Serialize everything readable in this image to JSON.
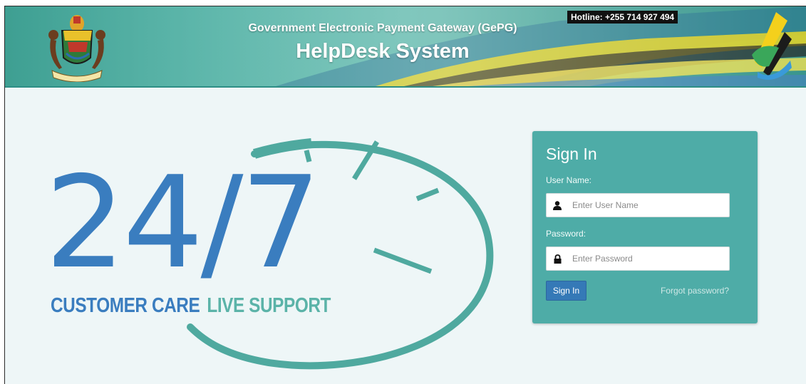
{
  "header": {
    "title": "Government Electronic Payment Gateway (GePG)",
    "subtitle": "HelpDesk System",
    "hotline": "Hotline: +255 714 927 494"
  },
  "hero": {
    "digits": "24/7",
    "tagline_left": "CUSTOMER CARE",
    "tagline_right": "LIVE SUPPORT"
  },
  "signin": {
    "title": "Sign In",
    "username_label": "User Name:",
    "username_placeholder": "Enter User Name",
    "username_value": "",
    "password_label": "Password:",
    "password_placeholder": "Enter Password",
    "password_value": "",
    "submit_label": "Sign In",
    "forgot_label": "Forgot password?"
  },
  "icons": [
    "coat-of-arms-icon",
    "gepg-logo-icon",
    "user-icon",
    "lock-icon"
  ],
  "colors": {
    "header_teal": "#4aaea1",
    "panel_teal": "#4eaca7",
    "brand_blue": "#3a7dbf",
    "support_green": "#5bb3a8",
    "button_blue": "#3579b7"
  }
}
